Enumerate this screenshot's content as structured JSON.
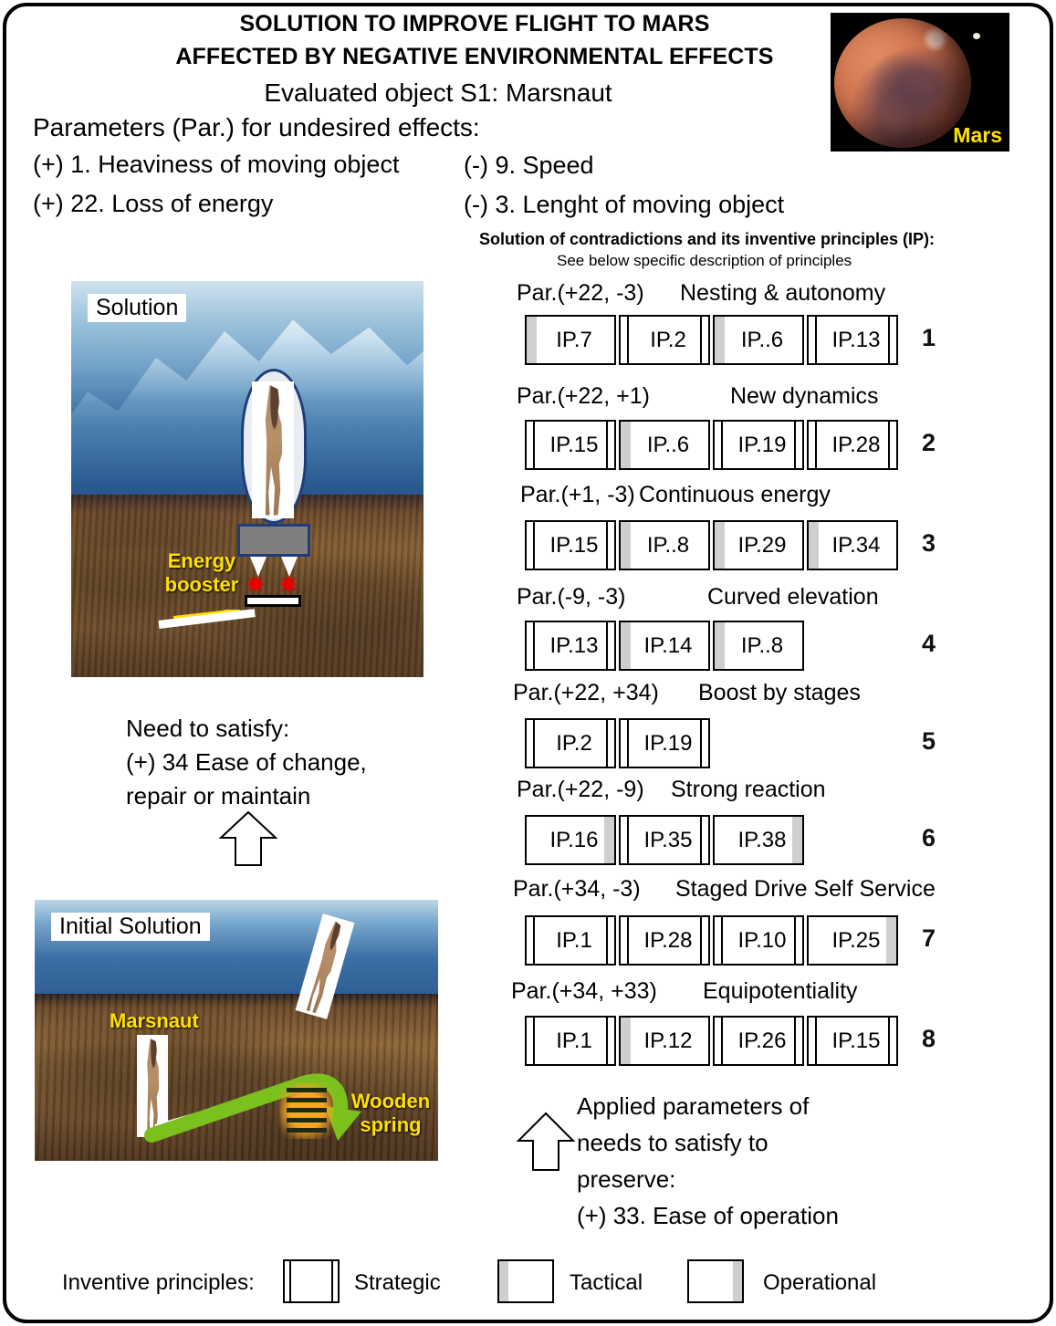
{
  "header": {
    "title_line1": "SOLUTION TO IMPROVE FLIGHT TO MARS",
    "title_line2": "AFFECTED BY NEGATIVE ENVIRONMENTAL EFFECTS",
    "subtitle": "Evaluated object S1: Marsnaut",
    "params_label": "Parameters (Par.) for undesired effects:",
    "params": [
      {
        "text": "(+) 1. Heaviness of moving object"
      },
      {
        "text": "(+) 22. Loss of energy"
      },
      {
        "text": "(-) 9.  Speed"
      },
      {
        "text": "(-) 3. Lenght  of  moving object"
      }
    ],
    "mars_label": "Mars"
  },
  "solution_panel": {
    "heading": "Solution of contradictions and its inventive principles (IP):",
    "subheading": "See below specific description of principles",
    "rows": [
      {
        "par": "Par.(+22, -3)",
        "name": "Nesting & autonomy",
        "number": "1",
        "boxes": [
          {
            "label": "IP.7",
            "kind": "tactical"
          },
          {
            "label": "IP.2",
            "kind": "strategic"
          },
          {
            "label": "IP..6",
            "kind": "tactical"
          },
          {
            "label": "IP.13",
            "kind": "strategic"
          }
        ]
      },
      {
        "par": "Par.(+22, +1)",
        "name": "New dynamics",
        "number": "2",
        "boxes": [
          {
            "label": "IP.15",
            "kind": "strategic"
          },
          {
            "label": "IP..6",
            "kind": "tactical"
          },
          {
            "label": "IP.19",
            "kind": "strategic"
          },
          {
            "label": "IP.28",
            "kind": "strategic"
          }
        ]
      },
      {
        "par": "Par.(+1, -3)",
        "name": "Continuous energy",
        "number": "3",
        "boxes": [
          {
            "label": "IP.15",
            "kind": "strategic"
          },
          {
            "label": "IP..8",
            "kind": "tactical"
          },
          {
            "label": "IP.29",
            "kind": "tactical"
          },
          {
            "label": "IP.34",
            "kind": "tactical"
          }
        ]
      },
      {
        "par": "Par.(-9, -3)",
        "name": "Curved elevation",
        "number": "4",
        "boxes": [
          {
            "label": "IP.13",
            "kind": "strategic"
          },
          {
            "label": "IP.14",
            "kind": "tactical"
          },
          {
            "label": "IP..8",
            "kind": "tactical"
          }
        ]
      },
      {
        "par": "Par.(+22, +34)",
        "name": "Boost by stages",
        "number": "5",
        "boxes": [
          {
            "label": "IP.2",
            "kind": "strategic"
          },
          {
            "label": "IP.19",
            "kind": "strategic"
          }
        ]
      },
      {
        "par": "Par.(+22, -9)",
        "name": "Strong reaction",
        "number": "6",
        "boxes": [
          {
            "label": "IP.16",
            "kind": "operational"
          },
          {
            "label": "IP.35",
            "kind": "strategic"
          },
          {
            "label": "IP.38",
            "kind": "operational"
          }
        ]
      },
      {
        "par": "Par.(+34, -3)",
        "name": "Staged Drive Self Service",
        "number": "7",
        "boxes": [
          {
            "label": "IP.1",
            "kind": "strategic"
          },
          {
            "label": "IP.28",
            "kind": "strategic"
          },
          {
            "label": "IP.10",
            "kind": "strategic"
          },
          {
            "label": "IP.25",
            "kind": "operational"
          }
        ]
      },
      {
        "par": "Par.(+34, +33)",
        "name": "Equipotentiality",
        "number": "8",
        "boxes": [
          {
            "label": "IP.1",
            "kind": "strategic"
          },
          {
            "label": "IP.12",
            "kind": "tactical"
          },
          {
            "label": "IP.26",
            "kind": "strategic"
          },
          {
            "label": "IP.15",
            "kind": "strategic"
          }
        ]
      }
    ]
  },
  "solution_image": {
    "label": "Solution",
    "booster_label": "Energy\nbooster"
  },
  "initial_image": {
    "label": "Initial Solution",
    "marsnaut_label": "Marsnaut",
    "spring_label": "Wooden\nspring"
  },
  "need_text": "Need to satisfy:\n(+) 34 Ease of change,\nrepair or maintain",
  "applied_text": "Applied parameters of\nneeds to satisfy to\npreserve:\n(+) 33. Ease of operation",
  "legend": {
    "title": "Inventive principles:",
    "items": [
      {
        "label": "Strategic",
        "kind": "strategic"
      },
      {
        "label": "Tactical",
        "kind": "tactical"
      },
      {
        "label": "Operational",
        "kind": "operational"
      }
    ]
  }
}
